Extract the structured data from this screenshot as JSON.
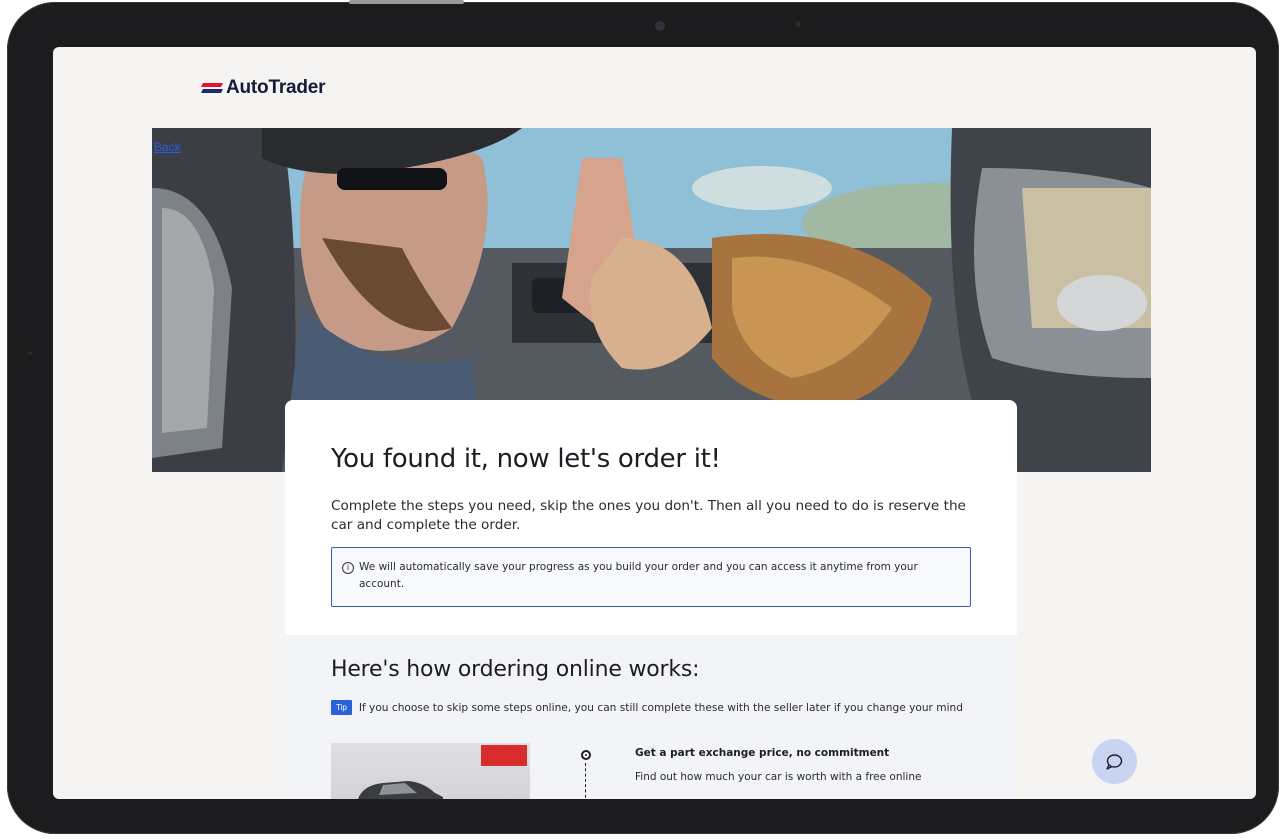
{
  "brand": {
    "name": "AutoTrader",
    "colors": {
      "red": "#e8112d",
      "navy": "#1b2a6b",
      "link": "#2b5ce6",
      "accent": "#2b63d6"
    }
  },
  "nav": {
    "back_label": "Back"
  },
  "hero": {
    "image": "photo of a man and child high-fiving inside a car"
  },
  "intro": {
    "title": "You found it, now let's order it!",
    "description": "Complete the steps you need, skip the ones you don't. Then all you need to do is reserve the car and complete the order.",
    "info_icon": "info-icon",
    "info_message": "We will automatically save your progress as you build your order and you can access it anytime from your account."
  },
  "how_it_works": {
    "title": "Here's how ordering online works:",
    "tip_badge": "Tip",
    "tip_text": "If you choose to skip some steps online, you can still complete these with the seller later if you change your mind",
    "steps": [
      {
        "title": "Get a part exchange price, no commitment",
        "description": "Find out how much your car is worth with a free online"
      }
    ]
  },
  "chat_button": {
    "icon": "chat-bubble-icon"
  }
}
